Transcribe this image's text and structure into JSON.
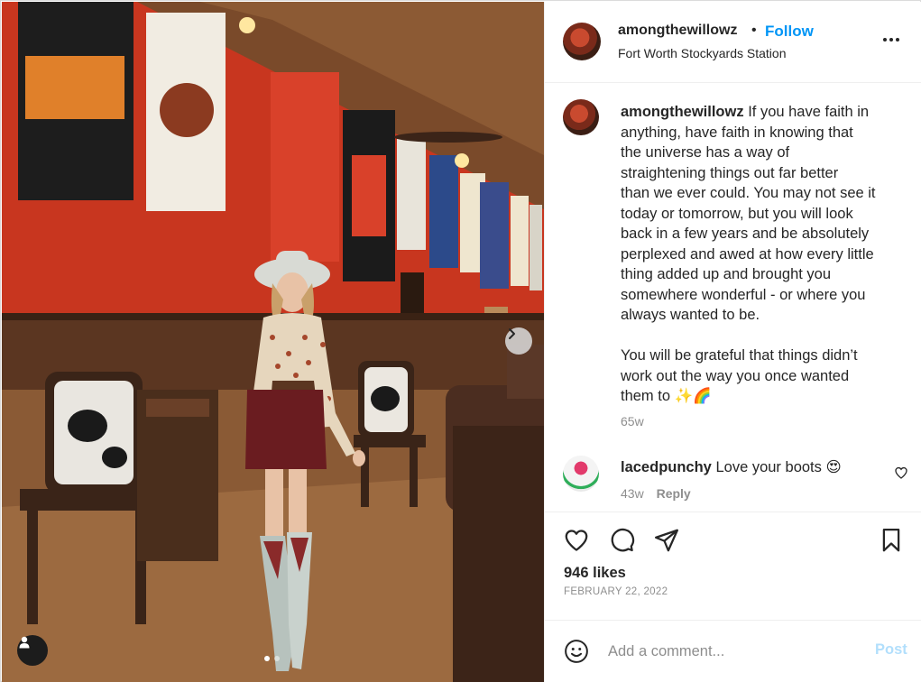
{
  "post": {
    "username": "amongthewillowz",
    "bullet": "•",
    "follow_label": "Follow",
    "location": "Fort Worth Stockyards Station"
  },
  "caption": {
    "username": "amongthewillowz",
    "lines": [
      "If you have faith in",
      "anything, have faith in knowing that",
      "the universe has a way of",
      "straightening things out far better",
      "than we ever could. You may not see it",
      "today or tomorrow, but you will look",
      "back in a few years and be absolutely",
      "perplexed and awed at how every little",
      "thing added up and brought you",
      "somewhere wonderful - or where you",
      "always wanted to be.",
      "",
      "You will be grateful that things didn’t",
      "work out the way you once wanted",
      "them to ✨🌈"
    ],
    "time": "65w"
  },
  "comment": {
    "username": "lacedpunchy",
    "text": "Love your boots 😍",
    "time": "43w",
    "reply_label": "Reply"
  },
  "stats": {
    "likes": "946 likes",
    "date": "FEBRUARY 22, 2022"
  },
  "add_comment": {
    "placeholder": "Add a comment...",
    "post_label": "Post"
  },
  "carousel": {
    "slide_count": 2,
    "active_index": 0
  },
  "colors": {
    "accent": "#0095f6",
    "post_disabled": "#b2dffc",
    "secondary_text": "#8e8e8e",
    "wall_red": "#c8361f"
  },
  "icons": [
    "more-options-icon",
    "heart-icon",
    "comment-icon",
    "share-icon",
    "bookmark-icon",
    "emoji-icon",
    "chevron-right-icon",
    "user-tag-icon"
  ]
}
